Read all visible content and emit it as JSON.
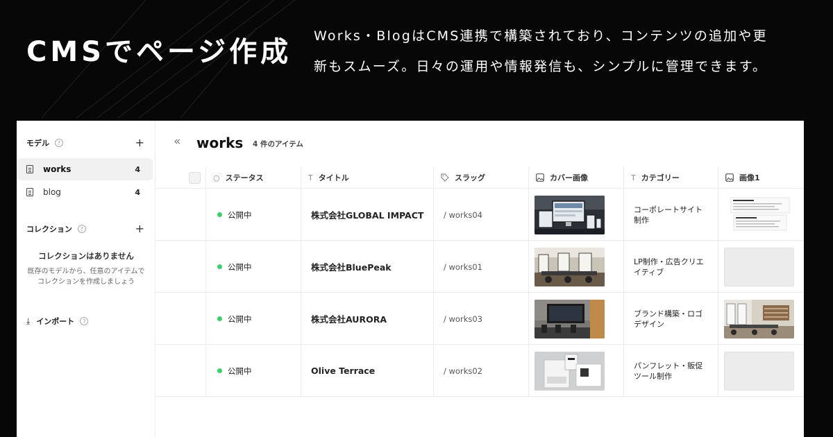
{
  "hero": {
    "headline": "CMSでページ作成",
    "description_line1": "Works・BlogはCMS連携で構築されており、コンテンツの追加や更",
    "description_line2": "新もスムーズ。日々の運用や情報発信も、シンプルに管理できます。"
  },
  "sidebar": {
    "models_label": "モデル",
    "models": [
      {
        "label": "works",
        "count": "4"
      },
      {
        "label": "blog",
        "count": "4"
      }
    ],
    "collections_label": "コレクション",
    "empty_title": "コレクションはありません",
    "empty_note_line1": "既存のモデルから、任意のアイテムで",
    "empty_note_line2": "コレクションを作成しましょう",
    "import_label": "インポート",
    "help_glyph": "?",
    "plus_glyph": "+"
  },
  "main": {
    "collapse_glyph": "«",
    "title": "works",
    "item_count": "4 件のアイテム",
    "columns": {
      "status": "ステータス",
      "title": "タイトル",
      "slug": "スラッグ",
      "cover": "カバー画像",
      "category": "カテゴリー",
      "image1": "画像1"
    },
    "rows": [
      {
        "status": "公開中",
        "title": "株式会社GLOBAL IMPACT",
        "slug": "/ works04",
        "category_l1": "コーポレートサイト",
        "category_l2": "制作",
        "cover": "devices-mockup",
        "image1": "document-preview"
      },
      {
        "status": "公開中",
        "title": "株式会社BluePeak",
        "slug": "/ works01",
        "category_l1": "LP制作・広告クリエ",
        "category_l2": "イティブ",
        "cover": "office-photo",
        "image1": "empty"
      },
      {
        "status": "公開中",
        "title": "株式会社AURORA",
        "slug": "/ works03",
        "category_l1": "ブランド構築・ロゴ",
        "category_l2": "デザイン",
        "cover": "wall-tv-photo",
        "image1": "cafe-interior"
      },
      {
        "status": "公開中",
        "title": "Olive Terrace",
        "slug": "/ works02",
        "category_l1": "パンフレット・販促",
        "category_l2": "ツール制作",
        "cover": "package-mockup",
        "image1": "empty"
      }
    ]
  },
  "colors": {
    "background": "#070707",
    "status_green": "#3ecf6a"
  }
}
